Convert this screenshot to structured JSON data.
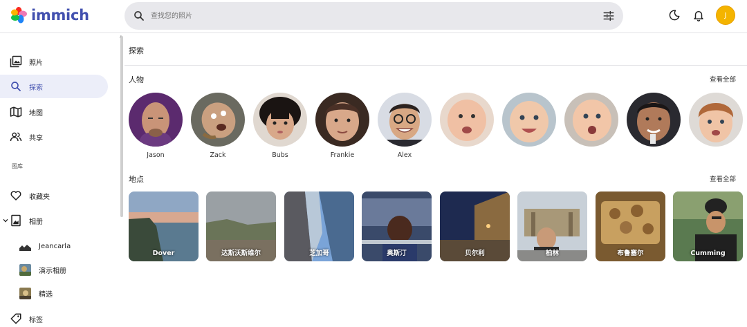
{
  "app": {
    "name": "immich"
  },
  "search": {
    "placeholder": "查找您的照片"
  },
  "user": {
    "initial": "J"
  },
  "sidebar": {
    "items": [
      {
        "label": "照片",
        "icon": "photos-icon"
      },
      {
        "label": "探索",
        "icon": "search-icon",
        "active": true
      },
      {
        "label": "地图",
        "icon": "map-icon"
      },
      {
        "label": "共享",
        "icon": "sharing-icon"
      }
    ],
    "library_label": "图库",
    "library_items": [
      {
        "label": "收藏夹",
        "icon": "heart-icon"
      },
      {
        "label": "相册",
        "icon": "album-icon"
      }
    ],
    "albums": [
      {
        "label": "Jeancarla"
      },
      {
        "label": "演示相册"
      },
      {
        "label": "精选"
      }
    ],
    "tags_label": "标签"
  },
  "main": {
    "title": "探索",
    "people": {
      "title": "人物",
      "view_all": "查看全部",
      "items": [
        {
          "name": "Jason"
        },
        {
          "name": "Zack"
        },
        {
          "name": "Bubs"
        },
        {
          "name": "Frankie"
        },
        {
          "name": "Alex"
        },
        {
          "name": ""
        },
        {
          "name": ""
        },
        {
          "name": ""
        },
        {
          "name": ""
        },
        {
          "name": ""
        }
      ]
    },
    "places": {
      "title": "地点",
      "view_all": "查看全部",
      "items": [
        {
          "name": "Dover"
        },
        {
          "name": "达斯沃斯维尔"
        },
        {
          "name": "芝加哥"
        },
        {
          "name": "奥斯汀"
        },
        {
          "name": "贝尔利"
        },
        {
          "name": "柏林"
        },
        {
          "name": "布鲁塞尔"
        },
        {
          "name": "Cumming"
        }
      ]
    }
  },
  "colors": {
    "brand": "#4250af",
    "active_bg": "#eceef9",
    "avatar": "#f4b400"
  }
}
